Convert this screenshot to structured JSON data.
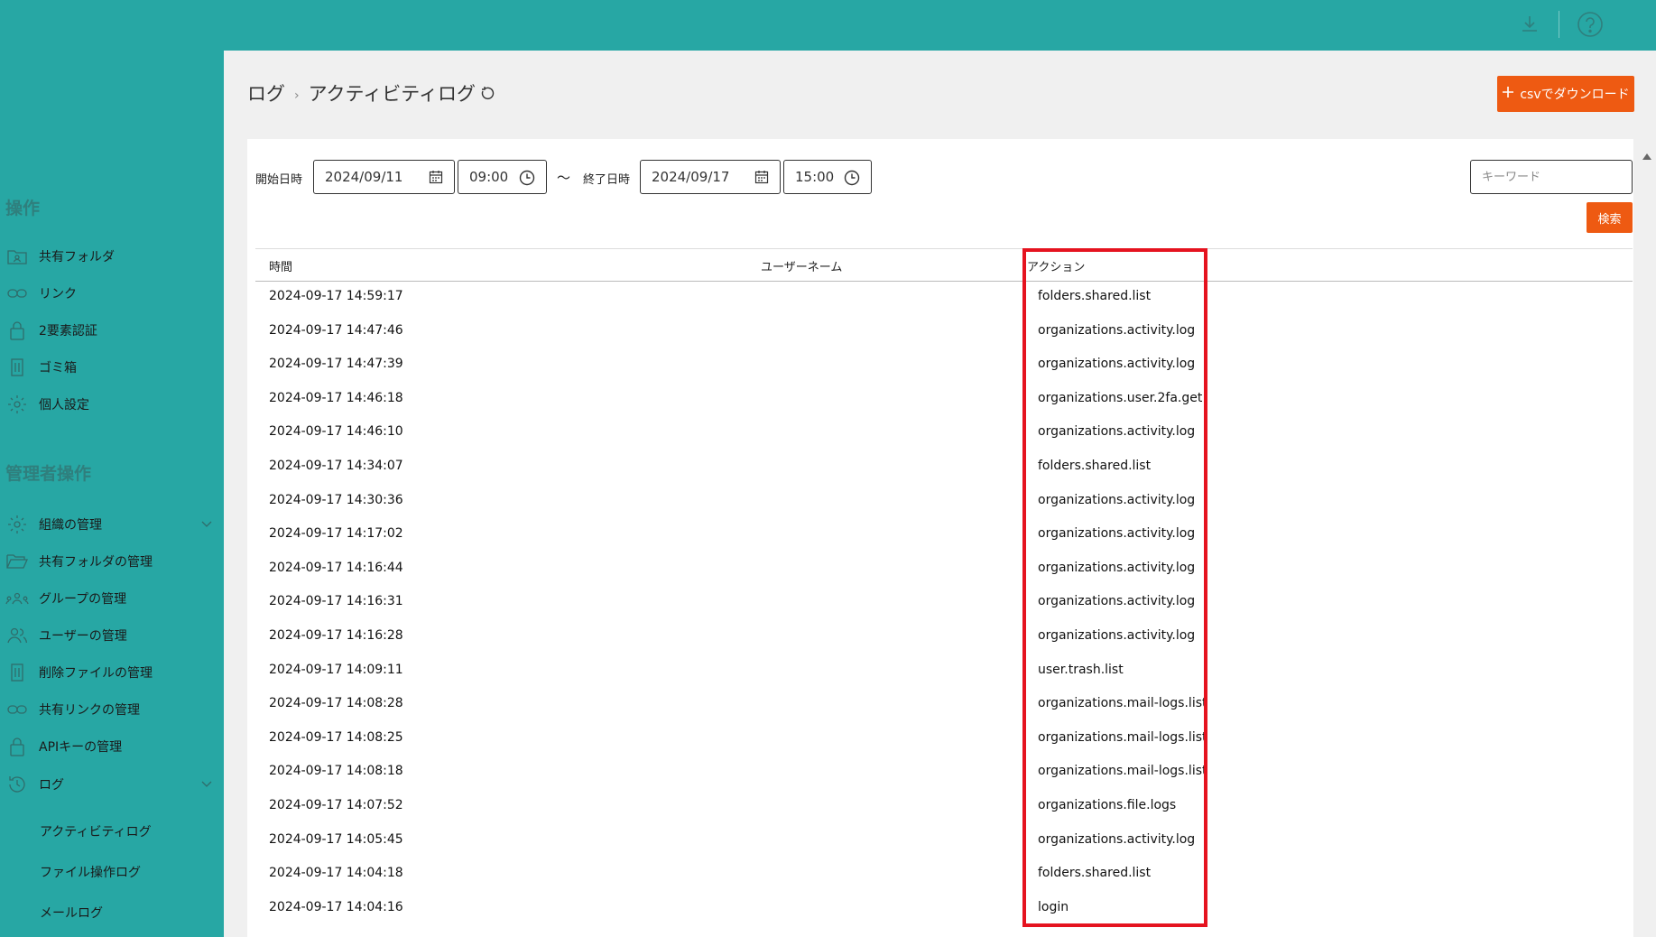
{
  "topbar": {
    "download_icon": "download-icon",
    "help_icon": "help-icon"
  },
  "sidebar": {
    "section_ops": "操作",
    "ops_items": [
      {
        "label": "共有フォルダ",
        "icon": "folder-user-icon"
      },
      {
        "label": "リンク",
        "icon": "link-icon"
      },
      {
        "label": "2要素認証",
        "icon": "lock-icon"
      },
      {
        "label": "ゴミ箱",
        "icon": "trash-icon"
      },
      {
        "label": "個人設定",
        "icon": "gear-icon"
      }
    ],
    "section_admin": "管理者操作",
    "admin_items": [
      {
        "label": "組織の管理",
        "icon": "gear-icon"
      },
      {
        "label": "共有フォルダの管理",
        "icon": "folder-open-icon"
      },
      {
        "label": "グループの管理",
        "icon": "group-icon"
      },
      {
        "label": "ユーザーの管理",
        "icon": "users-icon"
      },
      {
        "label": "削除ファイルの管理",
        "icon": "trash-icon"
      },
      {
        "label": "共有リンクの管理",
        "icon": "link-icon"
      },
      {
        "label": "APIキーの管理",
        "icon": "lock-icon"
      },
      {
        "label": "ログ",
        "icon": "history-icon"
      }
    ],
    "log_sub": [
      "アクティビティログ",
      "ファイル操作ログ",
      "メールログ"
    ]
  },
  "breadcrumb": {
    "parent": "ログ",
    "current": "アクティビティログ"
  },
  "download_button": "csvでダウンロード",
  "filters": {
    "start_label": "開始日時",
    "start_date": "2024/09/11",
    "start_time": "09:00",
    "tilde": "〜",
    "end_label": "終了日時",
    "end_date": "2024/09/17",
    "end_time": "15:00",
    "keyword_placeholder": "キーワード",
    "search_label": "検索"
  },
  "table": {
    "headers": [
      "時間",
      "ユーザーネーム",
      "アクション"
    ],
    "rows": [
      [
        "2024-09-17 14:59:17",
        "",
        "folders.shared.list"
      ],
      [
        "2024-09-17 14:47:46",
        "",
        "organizations.activity.log"
      ],
      [
        "2024-09-17 14:47:39",
        "",
        "organizations.activity.log"
      ],
      [
        "2024-09-17 14:46:18",
        "",
        "organizations.user.2fa.get"
      ],
      [
        "2024-09-17 14:46:10",
        "",
        "organizations.activity.log"
      ],
      [
        "2024-09-17 14:34:07",
        "",
        "folders.shared.list"
      ],
      [
        "2024-09-17 14:30:36",
        "",
        "organizations.activity.log"
      ],
      [
        "2024-09-17 14:17:02",
        "",
        "organizations.activity.log"
      ],
      [
        "2024-09-17 14:16:44",
        "",
        "organizations.activity.log"
      ],
      [
        "2024-09-17 14:16:31",
        "",
        "organizations.activity.log"
      ],
      [
        "2024-09-17 14:16:28",
        "",
        "organizations.activity.log"
      ],
      [
        "2024-09-17 14:09:11",
        "",
        "user.trash.list"
      ],
      [
        "2024-09-17 14:08:28",
        "",
        "organizations.mail-logs.list"
      ],
      [
        "2024-09-17 14:08:25",
        "",
        "organizations.mail-logs.list"
      ],
      [
        "2024-09-17 14:08:18",
        "",
        "organizations.mail-logs.list"
      ],
      [
        "2024-09-17 14:07:52",
        "",
        "organizations.file.logs"
      ],
      [
        "2024-09-17 14:05:45",
        "",
        "organizations.activity.log"
      ],
      [
        "2024-09-17 14:04:18",
        "",
        "folders.shared.list"
      ],
      [
        "2024-09-17 14:04:16",
        "",
        "login"
      ]
    ]
  },
  "colors": {
    "teal": "#27a7a4",
    "accent": "#ee5a12",
    "highlight": "#e5131f"
  }
}
